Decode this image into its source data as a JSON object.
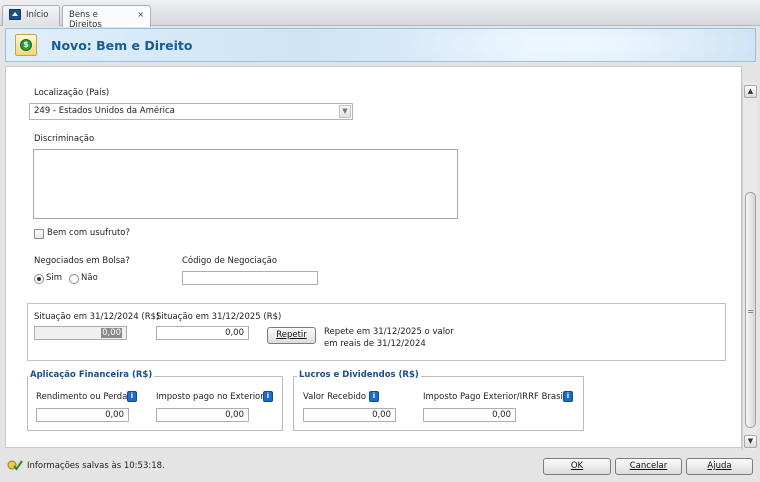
{
  "tabs": [
    {
      "label": "Início"
    },
    {
      "label": "Bens e Direitos",
      "close": "×"
    }
  ],
  "header": {
    "title": "Novo: Bem e Direito",
    "icon": "money-document-icon"
  },
  "form": {
    "localizacao_label": "Localização (País)",
    "localizacao_value": "249 - Estados Unidos da América",
    "discriminacao_label": "Discriminação",
    "discriminacao_value": "",
    "usufruto_label": "Bem com usufruto?",
    "usufruto_checked": false,
    "bolsa_label": "Negociados em Bolsa?",
    "bolsa_sim": "Sim",
    "bolsa_nao": "Não",
    "bolsa_selected": "Sim",
    "codigo_label": "Código de Negociação",
    "codigo_value": ""
  },
  "situacao": {
    "label_2024": "Situação em 31/12/2024 (R$)",
    "value_2024": "0,00",
    "label_2025": "Situação em 31/12/2025 (R$)",
    "value_2025": "0,00",
    "repetir_label": "Repetir",
    "repete_line1": "Repete em 31/12/2025 o valor",
    "repete_line2": "em reais de 31/12/2024"
  },
  "aplicacao": {
    "legend": "Aplicação Financeira (R$)",
    "rendimento_label": "Rendimento ou Perda",
    "rendimento_value": "0,00",
    "imposto_label": "Imposto pago no Exterior",
    "imposto_value": "0,00"
  },
  "lucros": {
    "legend": "Lucros e Dividendos (R$)",
    "valor_label": "Valor Recebido",
    "valor_value": "0,00",
    "imposto_label": "Imposto Pago Exterior/IRRF Brasil",
    "imposto_value": "0,00"
  },
  "status": {
    "text": "Informações salvas às 10:53:18."
  },
  "buttons": {
    "ok": "OK",
    "cancelar": "Cancelar",
    "ajuda": "Ajuda"
  },
  "colors": {
    "accent": "#1a5c93",
    "legend": "#1b4f8a",
    "info": "#1d6ac8"
  }
}
